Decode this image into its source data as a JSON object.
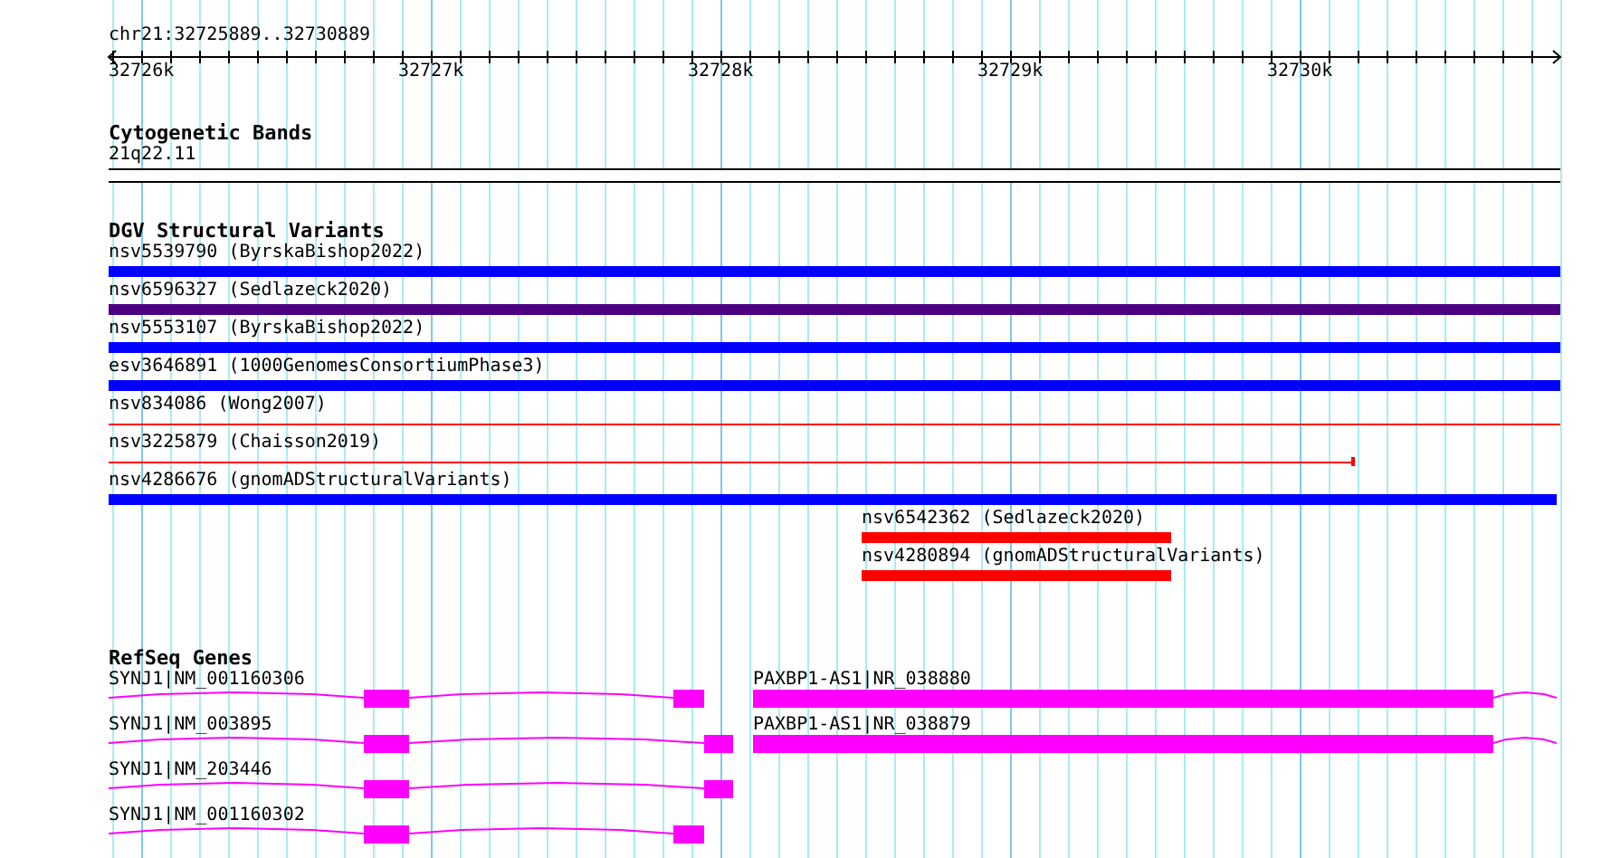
{
  "location": "chr21:32725889..32730889",
  "ruler": {
    "ticks": [
      "32726k",
      "32727k",
      "32728k",
      "32729k",
      "32730k"
    ]
  },
  "tracks": [
    {
      "kind": "bands",
      "title": "Cytogenetic Bands",
      "features": [
        {
          "label": "21q22.11"
        }
      ]
    },
    {
      "kind": "variants",
      "title": "DGV Structural Variants",
      "features": [
        {
          "label": "nsv5539790 (ByrskaBishop2022)",
          "kind": "bar",
          "color": "#0000ff"
        },
        {
          "label": "nsv6596327 (Sedlazeck2020)",
          "kind": "bar",
          "color": "#4b0082"
        },
        {
          "label": "nsv5553107 (ByrskaBishop2022)",
          "kind": "bar",
          "color": "#0000ff"
        },
        {
          "label": "esv3646891 (1000GenomesConsortiumPhase3)",
          "kind": "bar",
          "color": "#0000ff"
        },
        {
          "label": "nsv834086 (Wong2007)",
          "kind": "line",
          "color": "#ff0000"
        },
        {
          "label": "nsv3225879 (Chaisson2019)",
          "kind": "line",
          "color": "#ff0000"
        },
        {
          "label": "nsv4286676 (gnomADStructuralVariants)",
          "kind": "bar",
          "color": "#0000ff"
        },
        {
          "label": "nsv6542362 (Sedlazeck2020)",
          "kind": "bar",
          "color": "#ff0000"
        },
        {
          "label": "nsv4280894 (gnomADStructuralVariants)",
          "kind": "bar",
          "color": "#ff0000"
        }
      ]
    },
    {
      "kind": "genes",
      "title": "RefSeq Genes",
      "features": [
        {
          "label": "SYNJ1|NM_001160306"
        },
        {
          "label": "SYNJ1|NM_003895"
        },
        {
          "label": "SYNJ1|NM_203446"
        },
        {
          "label": "SYNJ1|NM_001160302"
        },
        {
          "label": "PAXBP1-AS1|NR_038880"
        },
        {
          "label": "PAXBP1-AS1|NR_038879"
        }
      ]
    }
  ]
}
